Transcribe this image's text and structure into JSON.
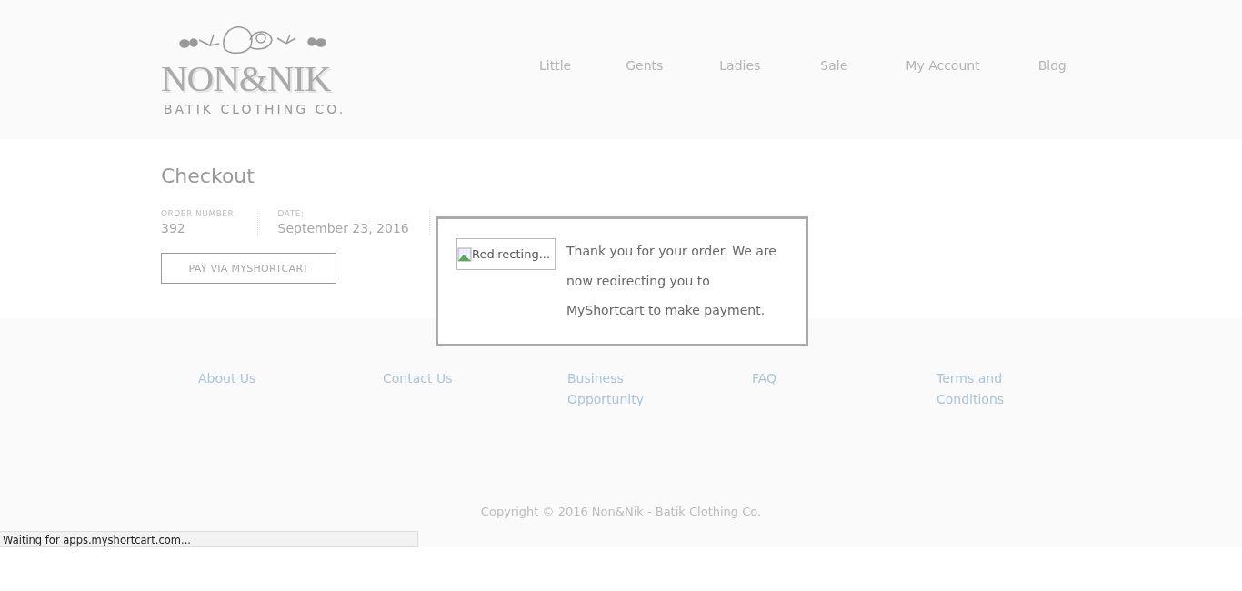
{
  "logo": {
    "name": "NON&NIK",
    "tagline": "BATIK CLOTHING CO."
  },
  "nav": [
    "Little",
    "Gents",
    "Ladies",
    "Sale",
    "My Account",
    "Blog"
  ],
  "page_title": "Checkout",
  "order_details": [
    {
      "label": "ORDER NUMBER:",
      "value": "392"
    },
    {
      "label": "DATE:",
      "value": "September 23, 2016"
    }
  ],
  "pay_button": "PAY VIA MYSHORTCART",
  "redirect_dialog": {
    "image_alt": "Redirecting...",
    "message": "Thank you for your order. We are now redirecting you to MyShortcart to make payment."
  },
  "footer_links": [
    "About Us",
    "Contact Us",
    "Business Opportunity",
    "FAQ",
    "Terms and Conditions"
  ],
  "copyright": "Copyright © 2016 Non&Nik - Batik Clothing Co.",
  "status_bar": "Waiting for apps.myshortcart.com..."
}
